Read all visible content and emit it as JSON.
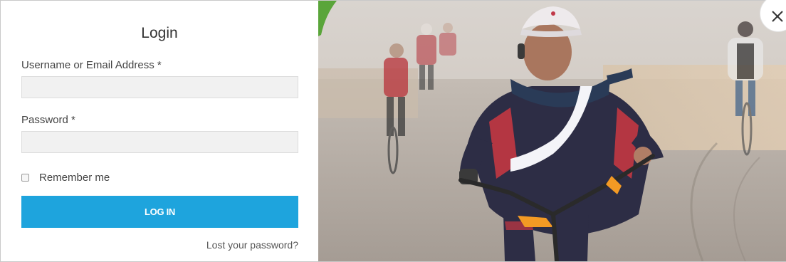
{
  "login": {
    "title": "Login",
    "username_label": "Username or Email Address *",
    "username_value": "",
    "password_label": "Password *",
    "password_value": "",
    "remember_label": "Remember me",
    "remember_checked": false,
    "submit_label": "LOG IN",
    "lost_password_label": "Lost your password?"
  },
  "photo": {
    "icon": "photo-cyclist"
  },
  "close": {
    "icon": "close-icon"
  },
  "colors": {
    "primary_button": "#1ea4dd",
    "input_background": "#f1f1f1"
  }
}
